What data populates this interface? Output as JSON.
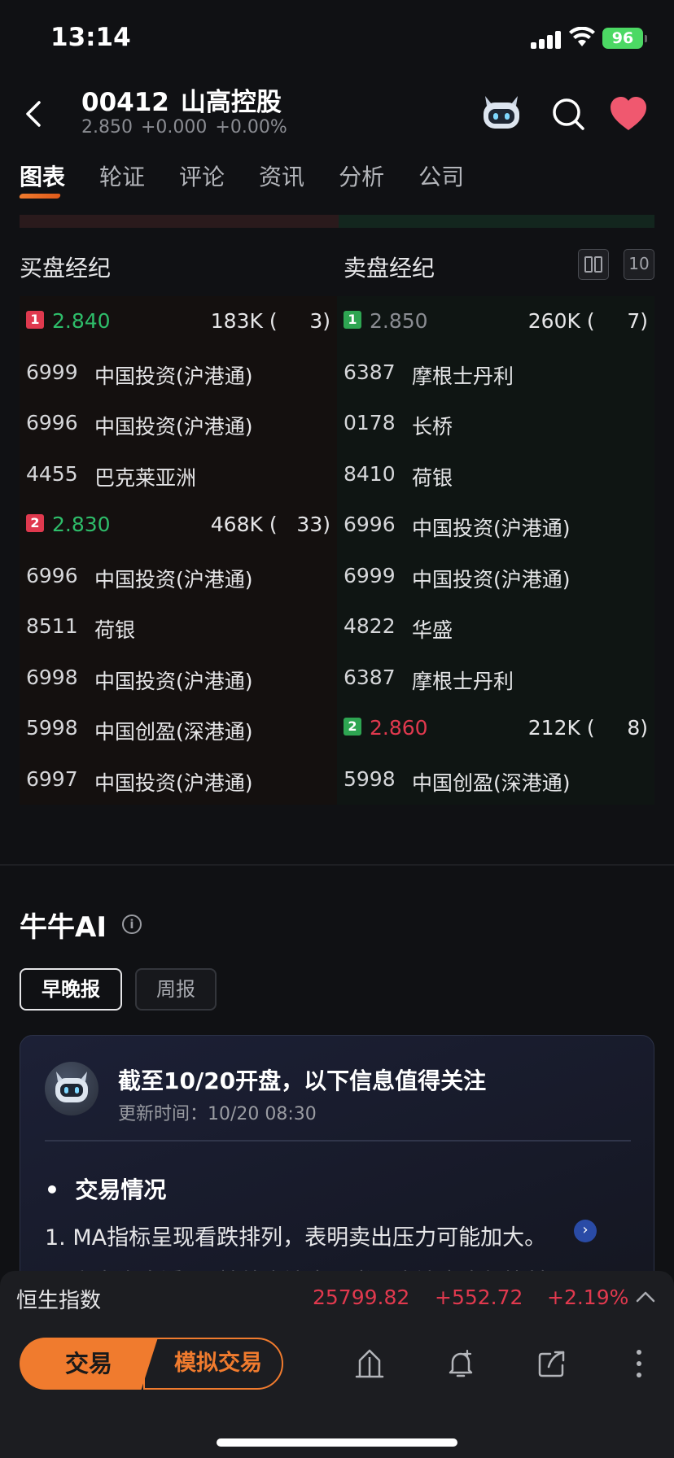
{
  "status_bar": {
    "time": "13:14",
    "battery": "96"
  },
  "header": {
    "code": "00412",
    "name": "山高控股",
    "price": "2.850",
    "change": "+0.000",
    "change_pct": "+0.00%"
  },
  "tabs": [
    {
      "label": "图表"
    },
    {
      "label": "轮证"
    },
    {
      "label": "评论"
    },
    {
      "label": "资讯"
    },
    {
      "label": "分析"
    },
    {
      "label": "公司"
    }
  ],
  "brokers": {
    "buy_label": "买盘经纪",
    "sell_label": "卖盘经纪",
    "tool_btn_2": "10",
    "buy_rows": [
      {
        "type": "level",
        "level": "1",
        "price": "2.840",
        "vol": "183K (     3)"
      },
      {
        "type": "broker",
        "code": "6999",
        "name": "中国投资(沪港通)"
      },
      {
        "type": "broker",
        "code": "6996",
        "name": "中国投资(沪港通)"
      },
      {
        "type": "broker",
        "code": "4455",
        "name": "巴克莱亚洲"
      },
      {
        "type": "level",
        "level": "2",
        "price": "2.830",
        "vol": "468K (   33)"
      },
      {
        "type": "broker",
        "code": "6996",
        "name": "中国投资(沪港通)"
      },
      {
        "type": "broker",
        "code": "8511",
        "name": "荷银"
      },
      {
        "type": "broker",
        "code": "6998",
        "name": "中国投资(沪港通)"
      },
      {
        "type": "broker",
        "code": "5998",
        "name": "中国创盈(深港通)"
      },
      {
        "type": "broker",
        "code": "6997",
        "name": "中国投资(沪港通)"
      }
    ],
    "sell_rows": [
      {
        "type": "level",
        "level": "1",
        "price": "2.850",
        "vol": "260K (     7)"
      },
      {
        "type": "broker",
        "code": "6387",
        "name": "摩根士丹利"
      },
      {
        "type": "broker",
        "code": "0178",
        "name": "长桥"
      },
      {
        "type": "broker",
        "code": "8410",
        "name": "荷银"
      },
      {
        "type": "broker",
        "code": "6996",
        "name": "中国投资(沪港通)"
      },
      {
        "type": "broker",
        "code": "6999",
        "name": "中国投资(沪港通)"
      },
      {
        "type": "broker",
        "code": "4822",
        "name": "华盛"
      },
      {
        "type": "broker",
        "code": "6387",
        "name": "摩根士丹利"
      },
      {
        "type": "level",
        "level": "2",
        "price": "2.860",
        "vol": "212K (     8)"
      },
      {
        "type": "broker",
        "code": "5998",
        "name": "中国创盈(深港通)"
      }
    ]
  },
  "ai": {
    "title": "牛牛AI",
    "tab_active": "早晚报",
    "tab_inactive": "周报",
    "card": {
      "title": "截至10/20开盘，以下信息值得关注",
      "updated": "更新时间：10/20 08:30",
      "section": "交易情况",
      "item1": "1. MA指标呈现看跌排列，表明卖出压力可能加大。",
      "item2": "2. 主力资金近7日持续净流出，当日净流出金额比前7..."
    }
  },
  "index_bar": {
    "name": "恒生指数",
    "value": "25799.82",
    "change": "+552.72",
    "change_pct": "+2.19%"
  },
  "bottom": {
    "trade": "交易",
    "sim_trade": "模拟交易"
  },
  "colors": {
    "accent": "#F07B2E",
    "up": "#E0394E",
    "down": "#2EBD6A",
    "background": "#101114"
  }
}
